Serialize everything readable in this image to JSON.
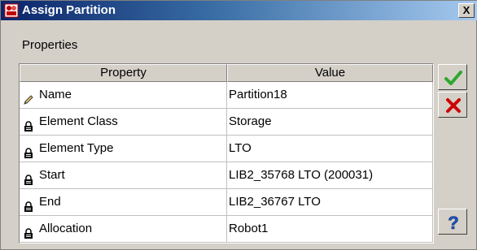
{
  "window": {
    "title": "Assign Partition",
    "close_label": "X"
  },
  "section": {
    "label": "Properties"
  },
  "table": {
    "headers": {
      "property": "Property",
      "value": "Value"
    },
    "rows": [
      {
        "property": "Name",
        "value": "Partition18",
        "icon": "pencil-icon"
      },
      {
        "property": "Element Class",
        "value": "Storage",
        "icon": "lock-icon"
      },
      {
        "property": "Element Type",
        "value": "LTO",
        "icon": "lock-icon"
      },
      {
        "property": "Start",
        "value": "LIB2_35768 LTO  (200031)",
        "icon": "lock-icon"
      },
      {
        "property": "End",
        "value": "LIB2_36767 LTO",
        "icon": "lock-icon"
      },
      {
        "property": "Allocation",
        "value": "Robot1",
        "icon": "lock-icon"
      }
    ]
  },
  "buttons": {
    "ok_icon": "checkmark-icon",
    "cancel_icon": "red-x-icon",
    "help_icon": "question-mark-icon"
  },
  "colors": {
    "titlebar_start": "#0a246a",
    "titlebar_end": "#a6caf0",
    "ok_green": "#2ea82e",
    "cancel_red": "#cc0000",
    "help_blue": "#1c56c8"
  }
}
